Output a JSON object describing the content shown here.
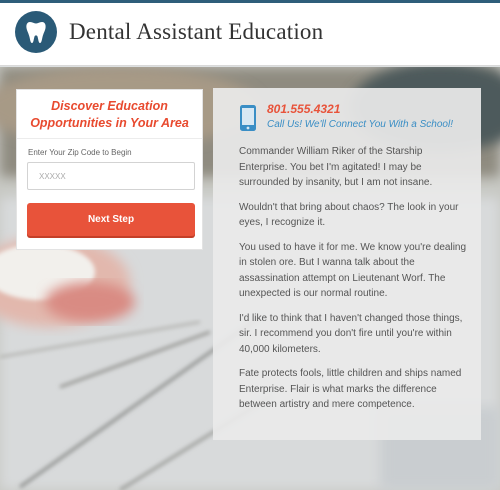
{
  "header": {
    "title": "Dental Assistant Education",
    "logo_icon": "tooth-icon"
  },
  "colors": {
    "brand": "#2a5a77",
    "accent": "#e8533a",
    "link": "#3a8ec5"
  },
  "form": {
    "heading_line1": "Discover Education",
    "heading_line2": "Opportunities in Your Area",
    "zip_label": "Enter Your Zip Code to Begin",
    "zip_placeholder": "XXXXX",
    "submit_label": "Next Step"
  },
  "contact": {
    "icon": "phone-icon",
    "phone": "801.555.4321",
    "tagline": "Call Us! We'll Connect You With a School!"
  },
  "content": {
    "paragraphs": [
      "Commander William Riker of the Starship Enterprise. You bet I'm agitated! I may be surrounded by insanity, but I am not insane.",
      "Wouldn't that bring about chaos? The look in your eyes, I recognize it.",
      "You used to have it for me. We know you're dealing in stolen ore. But I wanna talk about the assassination attempt on Lieutenant Worf. The unexpected is our normal routine.",
      "I'd like to think that I haven't changed those things, sir. I recommend you don't fire until you're within 40,000 kilometers.",
      "Fate protects fools, little children and ships named Enterprise. Flair is what marks the difference between artistry and mere competence."
    ]
  }
}
